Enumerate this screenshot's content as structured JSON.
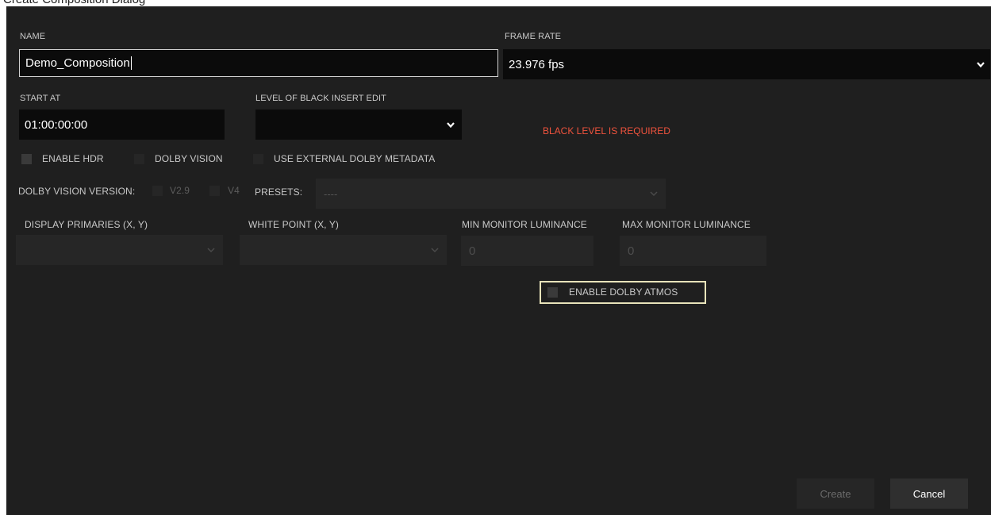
{
  "window": {
    "title": "Create Composition Dialog"
  },
  "form": {
    "name": {
      "label": "NAME",
      "value": "Demo_Composition"
    },
    "frame_rate": {
      "label": "FRAME RATE",
      "value": "23.976 fps"
    },
    "start_at": {
      "label": "START AT",
      "value": "01:00:00:00"
    },
    "black_level": {
      "label": "LEVEL OF BLACK INSERT EDIT",
      "value": "",
      "error": "BLACK LEVEL IS REQUIRED"
    },
    "enable_hdr": {
      "label": "ENABLE HDR",
      "checked": false
    },
    "dolby_vision": {
      "label": "DOLBY VISION",
      "checked": false
    },
    "external_metadata": {
      "label": "USE EXTERNAL DOLBY METADATA",
      "checked": false
    },
    "dv_version": {
      "label": "DOLBY VISION VERSION:",
      "options": [
        "V2.9",
        "V4"
      ]
    },
    "presets": {
      "label": "PRESETS:",
      "value": "----"
    },
    "display_primaries": {
      "label": "DISPLAY PRIMARIES (X, Y)",
      "value": ""
    },
    "white_point": {
      "label": "WHITE POINT (X, Y)",
      "value": ""
    },
    "min_luminance": {
      "label": "MIN MONITOR LUMINANCE",
      "value": "0"
    },
    "max_luminance": {
      "label": "MAX MONITOR LUMINANCE",
      "value": "0"
    },
    "dolby_atmos": {
      "label": "ENABLE DOLBY ATMOS",
      "checked": false
    }
  },
  "buttons": {
    "create": "Create",
    "cancel": "Cancel"
  },
  "icons": {
    "dropdown": "chevron-down-icon"
  },
  "colors": {
    "background": "#1f1f1f",
    "input": "#0b0b0b",
    "error": "#f0533d",
    "focus_outline": "#e8e3ba"
  }
}
